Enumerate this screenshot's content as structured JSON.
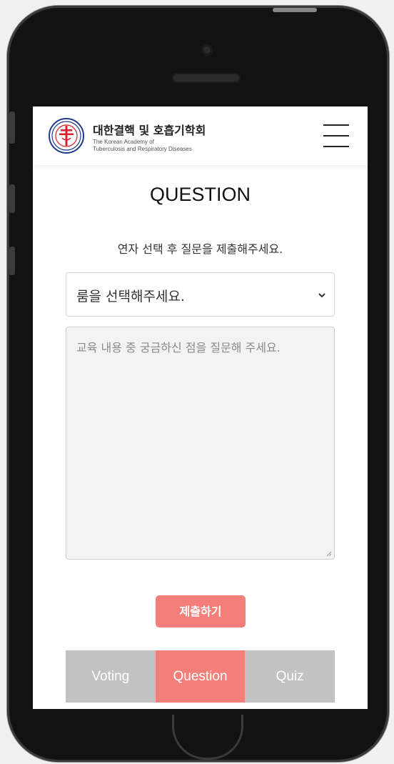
{
  "header": {
    "org_name": "대한결핵 및 호흡기학회",
    "org_name_en_line1": "The Korean Academy of",
    "org_name_en_line2": "Tuberculosis and Respiratory Diseases",
    "menu_icon": "hamburger-menu-icon"
  },
  "main": {
    "title": "QUESTION",
    "instruction": "연자 선택 후 질문을 제출해주세요.",
    "room_select": {
      "selected": "룸을 선택해주세요."
    },
    "question_input": {
      "placeholder": "교육 내용 중 궁금하신 점을 질문해 주세요."
    },
    "submit_label": "제출하기"
  },
  "tabs": [
    {
      "label": "Voting",
      "active": false
    },
    {
      "label": "Question",
      "active": true
    },
    {
      "label": "Quiz",
      "active": false
    }
  ],
  "colors": {
    "accent": "#f47f7a",
    "tab_inactive": "#c2c2c2",
    "emblem_red": "#d81e28",
    "emblem_blue": "#1f3a8a"
  }
}
